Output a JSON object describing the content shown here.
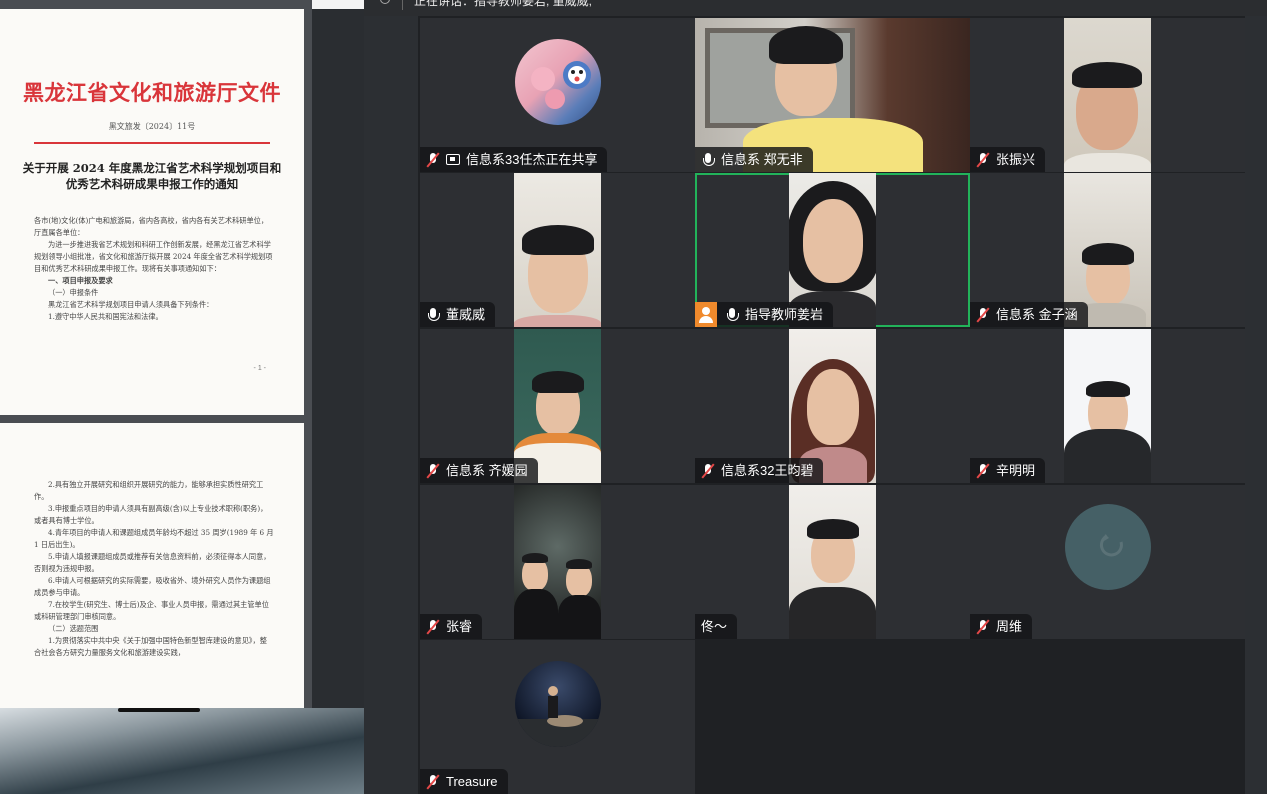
{
  "meeting": {
    "speaking_label": "正在讲话：指导教师姜岩; 董威威;",
    "participants": [
      {
        "name": "信息系33任杰正在共享",
        "mic": "muted",
        "sharing": true,
        "video": false
      },
      {
        "name": "信息系 郑无非",
        "mic": "on",
        "video": true
      },
      {
        "name": "张振兴",
        "mic": "muted",
        "video": true
      },
      {
        "name": "董威威",
        "mic": "on",
        "video": true
      },
      {
        "name": "指导教师姜岩",
        "mic": "on",
        "host": true,
        "active_speaker": true,
        "video": true
      },
      {
        "name": "信息系 金子涵",
        "mic": "muted",
        "video": true
      },
      {
        "name": "信息系 齐媛园",
        "mic": "muted",
        "video": true
      },
      {
        "name": "信息系32王昀碧",
        "mic": "muted",
        "video": true
      },
      {
        "name": "辛明明",
        "mic": "muted",
        "video": true
      },
      {
        "name": "张睿",
        "mic": "muted",
        "video": true
      },
      {
        "name": "佟～",
        "mic": "none",
        "video": true
      },
      {
        "name": "周维",
        "mic": "muted",
        "video": false
      },
      {
        "name": "Treasure",
        "mic": "muted",
        "video": false
      }
    ]
  },
  "document": {
    "header": "黑龙江省文化和旅游厅文件",
    "doc_number": "黑文旅发〔2024〕11号",
    "title": "关于开展 2024 年度黑龙江省艺术科学规划项目和优秀艺术科研成果申报工作的通知",
    "page1_paragraphs": [
      "各市(地)文化(体)广电和旅游局，省内各高校，省内各有关艺术科研单位，厅直属各单位：",
      "为进一步推进我省艺术规划和科研工作创新发展，经黑龙江省艺术科学规划领导小组批准，省文化和旅游厅拟开展 2024 年度全省艺术科学规划项目和优秀艺术科研成果申报工作。现将有关事项通知如下：",
      "一、项目申报及要求",
      "（一）申报条件",
      "黑龙江省艺术科学规划项目申请人须具备下列条件：",
      "1.遵守中华人民共和国宪法和法律。"
    ],
    "page1_number": "- 1 -",
    "page2_paragraphs": [
      "2.具有独立开展研究和组织开展研究的能力，能够承担实质性研究工作。",
      "3.申报重点项目的申请人须具有副高级(含)以上专业技术职称(职务)，或者具有博士学位。",
      "4.青年项目的申请人和课题组成员年龄均不超过 35 周岁(1989 年 6 月 1 日后出生)。",
      "5.申请人填报课题组成员或推荐有关信息资料前，必须征得本人同意，否则视为违规申报。",
      "6.申请人可根据研究的实际需要，吸收省外、境外研究人员作为课题组成员参与申请。",
      "7.在校学生(研究生、博士后)及企、事业人员申报，需通过其主管单位或科研管理部门审核同意。",
      "（二）选题范围",
      "1.为贯彻落实中共中央《关于加强中国特色新型智库建设的意见》，整合社会各方研究力量服务文化和旅游建设实践，"
    ]
  },
  "colors": {
    "active_speaker_border": "#22b35a",
    "host_badge": "#f08a2c",
    "muted_slash": "#e54848",
    "doc_header_red": "#d9353a"
  }
}
